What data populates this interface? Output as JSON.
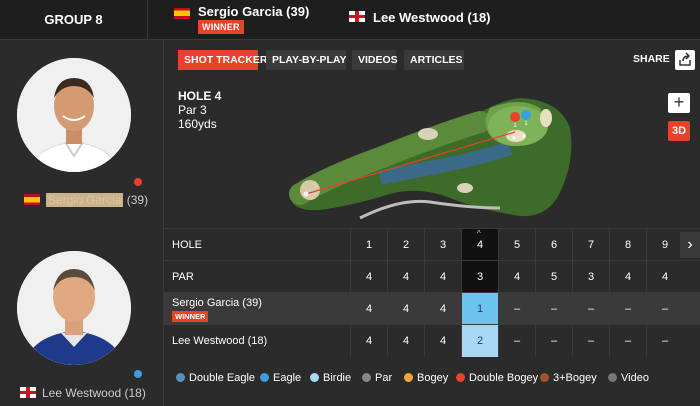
{
  "group": "GROUP 8",
  "players": [
    {
      "name": "Sergio Garcia (39)",
      "short": "Sergio Garcia",
      "rank": "(39)",
      "badge": "WINNER",
      "flag": "spain-flag"
    },
    {
      "name": "Lee Westwood (18)",
      "short": "Lee Westwood",
      "rank": "(18)",
      "flag": "england-flag"
    }
  ],
  "tabs": [
    "SHOT TRACKER",
    "PLAY-BY-PLAY",
    "VIDEOS",
    "ARTICLES"
  ],
  "share": "SHARE",
  "hole_info": {
    "hole": "HOLE 4",
    "par": "Par 3",
    "yards": "160yds"
  },
  "controls": {
    "zoom": "+",
    "view3d": "3D"
  },
  "scorecard": {
    "hole_label": "HOLE",
    "par_label": "PAR",
    "holes": [
      "1",
      "2",
      "3",
      "4",
      "5",
      "6",
      "7",
      "8",
      "9"
    ],
    "par": [
      "4",
      "4",
      "4",
      "3",
      "4",
      "5",
      "3",
      "4",
      "4"
    ],
    "p1_label": "Sergio Garcia (39)",
    "p1_badge": "WINNER",
    "p1": [
      "4",
      "4",
      "4",
      "1",
      "–",
      "–",
      "–",
      "–",
      "–"
    ],
    "p2_label": "Lee Westwood (18)",
    "p2": [
      "4",
      "4",
      "4",
      "2",
      "–",
      "–",
      "–",
      "–",
      "–"
    ]
  },
  "legend": [
    {
      "label": "Double Eagle",
      "color": "#5a8fb8"
    },
    {
      "label": "Eagle",
      "color": "#3aa0e0"
    },
    {
      "label": "Birdie",
      "color": "#a8d8f4"
    },
    {
      "label": "Par",
      "color": "#888888"
    },
    {
      "label": "Bogey",
      "color": "#f2a43a"
    },
    {
      "label": "Double Bogey",
      "color": "#e8412c"
    },
    {
      "label": "3+Bogey",
      "color": "#a0522d"
    },
    {
      "label": "Video",
      "color": "#777777"
    }
  ],
  "colors": {
    "accent": "#e8412c",
    "bg": "#2b2b2b",
    "birdie": "#6cc3ee"
  }
}
